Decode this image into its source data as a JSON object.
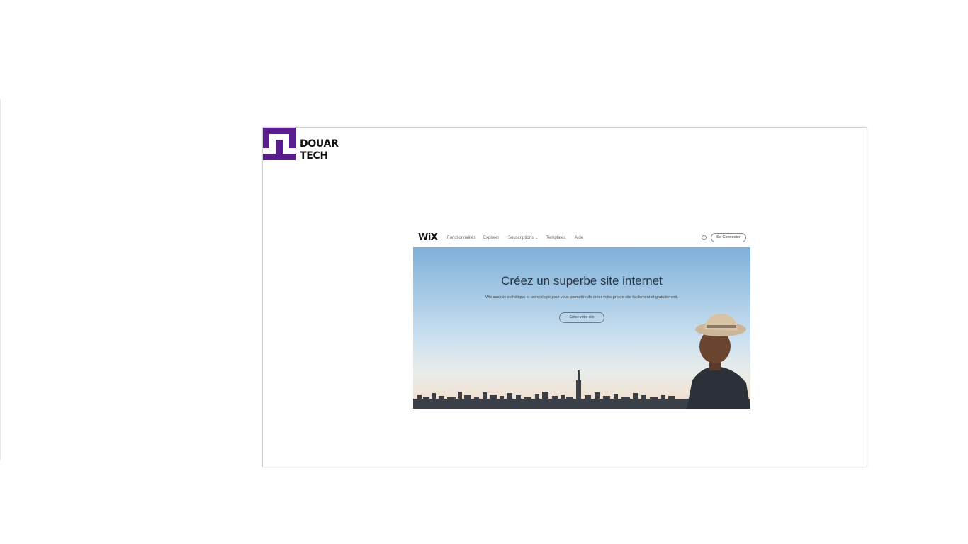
{
  "brand": {
    "line1": "DOUAR",
    "line2": "TECH",
    "color": "#5a1d8e"
  },
  "wix": {
    "logo": "WiX",
    "nav": [
      "Fonctionnalités",
      "Explorer",
      "Souscriptions",
      "Templates",
      "Aide"
    ],
    "signin": "Se Connecter",
    "hero_title": "Créez un superbe site internet",
    "hero_subtitle": "Wix associe esthétique et technologie pour vous permettre de créer votre propre site facilement et gratuitement.",
    "cta": "Créez votre site"
  }
}
